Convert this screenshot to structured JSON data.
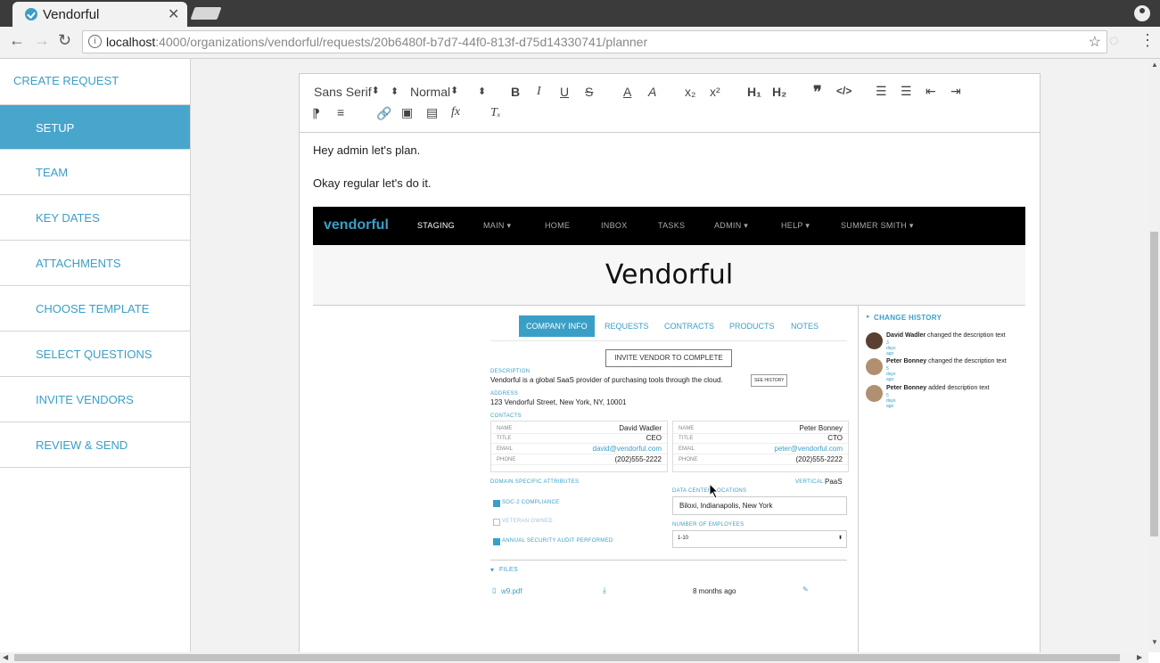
{
  "browser": {
    "tab_title": "Vendorful",
    "url_host": "localhost",
    "url_path": ":4000/organizations/vendorful/requests/20b6480f-b7d7-44f0-813f-d75d14330741/planner"
  },
  "sidebar": {
    "create_request": "CREATE REQUEST",
    "items": [
      {
        "label": "SETUP"
      },
      {
        "label": "TEAM"
      },
      {
        "label": "KEY DATES"
      },
      {
        "label": "ATTACHMENTS"
      },
      {
        "label": "CHOOSE TEMPLATE"
      },
      {
        "label": "SELECT QUESTIONS"
      },
      {
        "label": "INVITE VENDORS"
      },
      {
        "label": "REVIEW & SEND"
      }
    ]
  },
  "editor": {
    "font_select": "Sans Serif",
    "size_select": "Normal",
    "paragraphs": [
      "Hey admin let's plan.",
      "Okay regular let's do it."
    ]
  },
  "embedded": {
    "logo": "vendorful",
    "nav": [
      "STAGING",
      "MAIN ▾",
      "HOME",
      "INBOX",
      "TASKS",
      "ADMIN ▾",
      "HELP ▾",
      "SUMMER SMITH ▾"
    ],
    "title": "Vendorful",
    "tabs": [
      "COMPANY INFO",
      "REQUESTS",
      "CONTRACTS",
      "PRODUCTS",
      "NOTES"
    ],
    "invite_button": "INVITE VENDOR TO COMPLETE",
    "description_label": "DESCRIPTION",
    "description": "Vendorful is a global SaaS provider of purchasing tools through the cloud.",
    "see_history": "SEE HISTORY",
    "address_label": "ADDRESS",
    "address": "123 Vendorful Street, New York, NY, 10001",
    "contacts_label": "CONTACTS",
    "contacts": [
      {
        "name": "David Wadler",
        "title": "CEO",
        "email": "david@vendorful.com",
        "phone": "(202)555-2222"
      },
      {
        "name": "Peter Bonney",
        "title": "CTO",
        "email": "peter@vendorful.com",
        "phone": "(202)555-2222"
      }
    ],
    "contact_keys": {
      "name": "NAME",
      "title": "TITLE",
      "email": "EMAIL",
      "phone": "PHONE"
    },
    "domain_label": "DOMAIN SPECIFIC ATTRIBUTES",
    "vertical_label": "VERTICAL",
    "vertical": "PaaS",
    "checks": [
      {
        "label": "SOC-2 COMPLIANCE",
        "checked": true
      },
      {
        "label": "VETERAN OWNED",
        "checked": false
      },
      {
        "label": "ANNUAL SECURITY AUDIT PERFORMED",
        "checked": true
      }
    ],
    "data_center_label": "DATA CENTER LOCATIONS",
    "data_center": "Biloxi, Indianapolis, New York",
    "employees_label": "NUMBER OF EMPLOYEES",
    "employees": "1-10",
    "files_label": "FILES",
    "file_name": "w9.pdf",
    "file_age": "8 months ago",
    "history_title": "CHANGE HISTORY",
    "history": [
      {
        "who": "David Wadler",
        "what": "changed the description text",
        "when": "3 days ago"
      },
      {
        "who": "Peter Bonney",
        "what": "changed the description text",
        "when": "5 days ago"
      },
      {
        "who": "Peter Bonney",
        "what": "added description text",
        "when": "5 days ago"
      }
    ]
  }
}
